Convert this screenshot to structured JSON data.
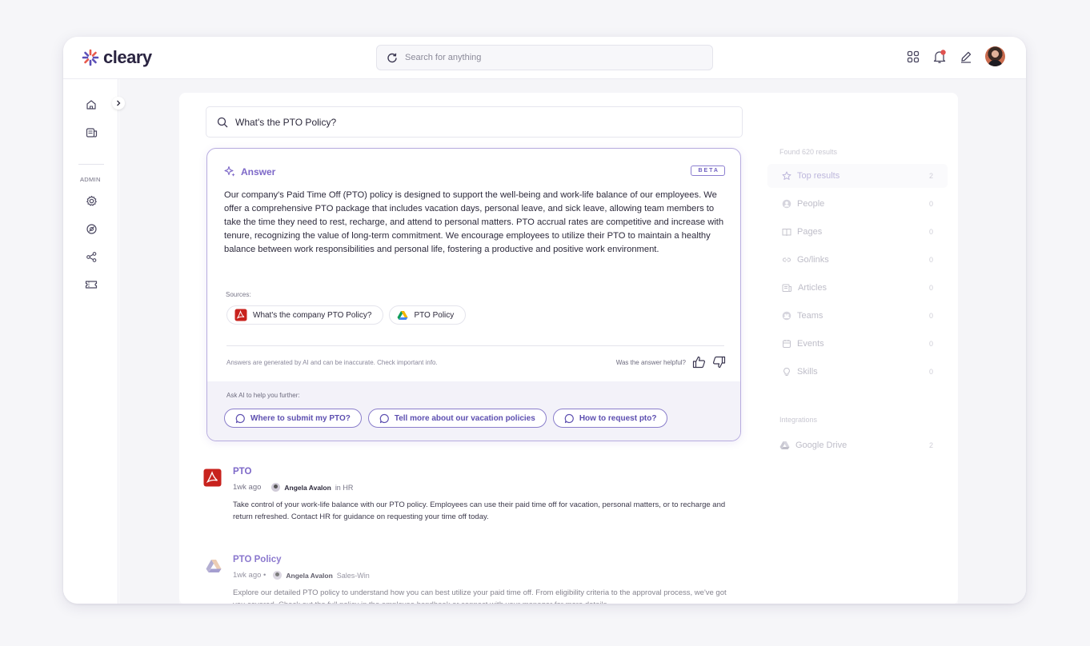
{
  "app": {
    "name": "cleary"
  },
  "topbar": {
    "search_placeholder": "Search for anything"
  },
  "leftrail": {
    "section_label": "ADMIN"
  },
  "query": {
    "value": "What's the PTO Policy?"
  },
  "answer": {
    "heading": "Answer",
    "badge": "BETA",
    "text": "Our company's Paid Time Off (PTO) policy is designed to support the well-being and work-life balance of our employees. We offer a comprehensive PTO package that includes vacation days, personal leave, and sick leave, allowing team members to take the time they need to rest, recharge, and attend to personal matters. PTO accrual rates are competitive and increase with tenure, recognizing the value of long-term commitment. We encourage employees to utilize their PTO to maintain a healthy balance between work responsibilities and personal life, fostering a productive and positive work environment.",
    "sources_label": "Sources:",
    "sources": [
      {
        "label": "What's the company PTO Policy?",
        "icon": "pdf-icon"
      },
      {
        "label": "PTO Policy",
        "icon": "google-drive-icon"
      }
    ],
    "disclaimer": "Answers are generated by AI and can be inaccurate. Check important info.",
    "helpful_label": "Was the answer helpful?",
    "ask_label": "Ask AI to help you further:",
    "suggestions": [
      "Where to submit my PTO?",
      "Tell more about our vacation policies",
      "How to request pto?"
    ]
  },
  "results": [
    {
      "title": "PTO",
      "time": "1wk ago",
      "author": "Angela Avalon",
      "in_label": "in HR",
      "description": "Take control of your work-life balance with our PTO policy. Employees can use their paid time off for vacation, personal matters, or to recharge and return refreshed. Contact HR for guidance on requesting your time off today."
    },
    {
      "title": "PTO Policy",
      "time": "1wk ago •",
      "author": "Angela Avalon",
      "in_label": "Sales-Win",
      "description": "Explore our detailed PTO policy to understand how you can best utilize your paid time off. From eligibility criteria to the approval process, we've got you covered. Check out the full policy in the employee handbook or connect with your manager for more details."
    }
  ],
  "sidebar": {
    "found_label": "Found 620 results",
    "filters": [
      {
        "label": "Top results",
        "count": "2",
        "icon": "star-icon"
      },
      {
        "label": "People",
        "count": "0",
        "icon": "person-icon"
      },
      {
        "label": "Pages",
        "count": "0",
        "icon": "book-icon"
      },
      {
        "label": "Go/links",
        "count": "0",
        "icon": "link-icon"
      },
      {
        "label": "Articles",
        "count": "0",
        "icon": "article-icon"
      },
      {
        "label": "Teams",
        "count": "0",
        "icon": "team-icon"
      },
      {
        "label": "Events",
        "count": "0",
        "icon": "calendar-icon"
      },
      {
        "label": "Skills",
        "count": "0",
        "icon": "bulb-icon"
      }
    ],
    "integrations_label": "Integrations",
    "integrations": [
      {
        "label": "Google Drive",
        "count": "2",
        "icon": "google-drive-icon"
      }
    ]
  },
  "colors": {
    "accent": "#7d68c8",
    "accent_border": "#b7acdf",
    "pdf_red": "#c8221d"
  }
}
